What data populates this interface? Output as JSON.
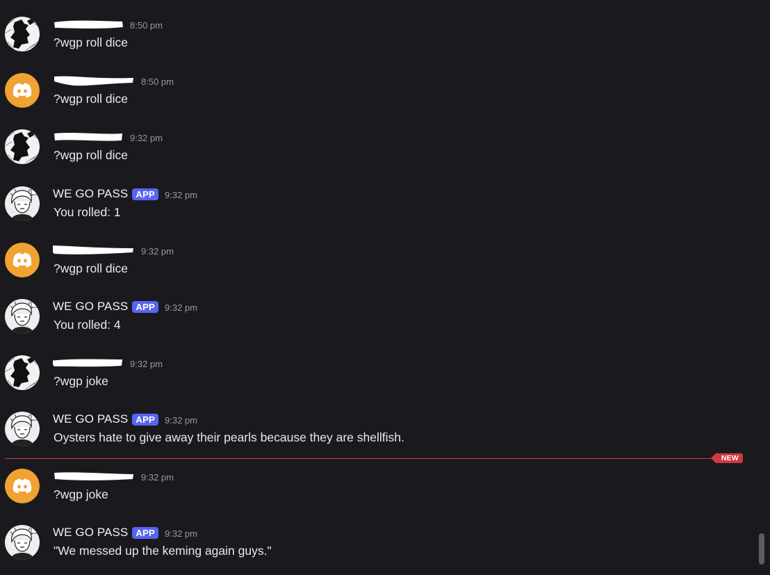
{
  "colors": {
    "background": "#1a1a1e",
    "app_badge": "#5865f2",
    "new_divider": "#d0393e",
    "discord_avatar": "#f0a232"
  },
  "messages": [
    {
      "author": "",
      "author_redacted": true,
      "avatar": "user-silhouette-avatar",
      "bot_badge": "",
      "time": "8:50 pm",
      "text": "?wgp roll dice"
    },
    {
      "author": "",
      "author_redacted": true,
      "avatar": "discord-logo-avatar",
      "bot_badge": "",
      "time": "8:50 pm",
      "text": "?wgp roll dice"
    },
    {
      "author": "",
      "author_redacted": true,
      "avatar": "user-silhouette-avatar",
      "bot_badge": "",
      "time": "9:32 pm",
      "text": "?wgp roll dice"
    },
    {
      "author": "WE GO PASS",
      "author_redacted": false,
      "avatar": "manga-portrait-avatar",
      "bot_badge": "APP",
      "time": "9:32 pm",
      "text": "You rolled: 1"
    },
    {
      "author": "",
      "author_redacted": true,
      "avatar": "discord-logo-avatar",
      "bot_badge": "",
      "time": "9:32 pm",
      "text": "?wgp roll dice"
    },
    {
      "author": "WE GO PASS",
      "author_redacted": false,
      "avatar": "manga-portrait-avatar",
      "bot_badge": "APP",
      "time": "9:32 pm",
      "text": "You rolled: 4"
    },
    {
      "author": "",
      "author_redacted": true,
      "avatar": "user-silhouette-avatar",
      "bot_badge": "",
      "time": "9:32 pm",
      "text": "?wgp joke"
    },
    {
      "author": "WE GO PASS",
      "author_redacted": false,
      "avatar": "manga-portrait-avatar",
      "bot_badge": "APP",
      "time": "9:32 pm",
      "text": "Oysters hate to give away their pearls because they are shellfish."
    },
    {
      "author": "",
      "author_redacted": true,
      "avatar": "discord-logo-avatar",
      "bot_badge": "",
      "time": "9:32 pm",
      "text": "?wgp joke"
    },
    {
      "author": "WE GO PASS",
      "author_redacted": false,
      "avatar": "manga-portrait-avatar",
      "bot_badge": "APP",
      "time": "9:32 pm",
      "text": "\"We messed up the keming again guys.\""
    }
  ],
  "divider": {
    "label": "NEW",
    "after_message_index": 7
  }
}
